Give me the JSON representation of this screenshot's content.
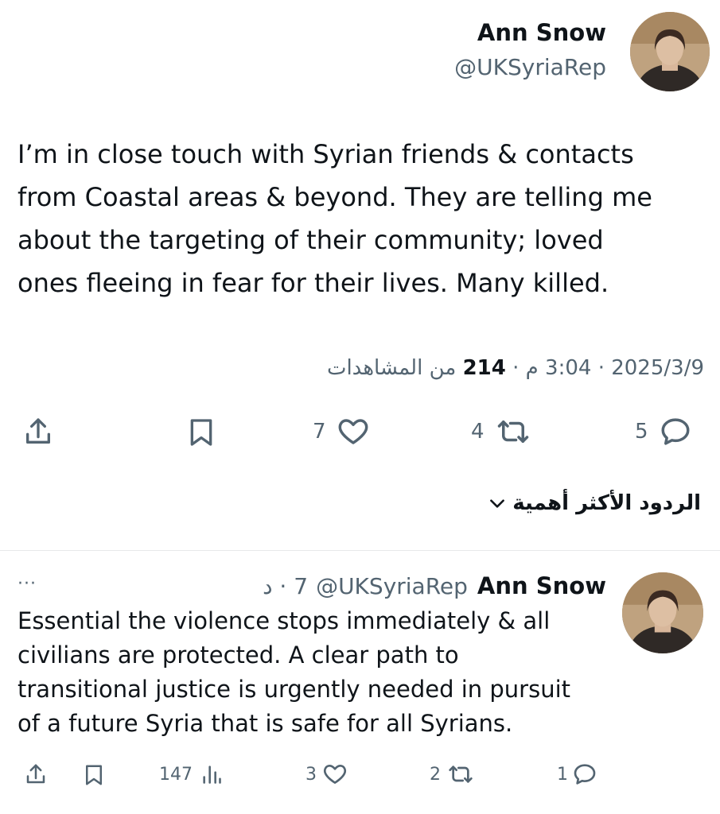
{
  "tweet": {
    "author_name": "Ann Snow",
    "author_handle": "@UKSyriaRep",
    "text": "I’m in close touch with Syrian friends & contacts\nfrom Coastal areas & beyond. They are telling me\nabout the targeting of their community; loved\nones fleeing in fear for their lives. Many killed.",
    "date": "2025/3/9",
    "time": "3:04 م",
    "views_count": "214",
    "views_label": "من المشاهدات",
    "separator": "·",
    "replies": "5",
    "retweets": "4",
    "likes": "7"
  },
  "replies_sort": {
    "label": "الردود الأكثر أهمية"
  },
  "reply": {
    "author_name": "Ann Snow",
    "author_handle": "@UKSyriaRep",
    "time_ago": "7 · د",
    "more": "···",
    "text": "Essential the violence stops immediately & all\ncivilians are protected. A clear path to\ntransitional justice is urgently needed in pursuit\nof a future Syria that is safe for all Syrians.",
    "replies": "1",
    "retweets": "2",
    "likes": "3",
    "views": "147"
  },
  "icons": {
    "reply": "reply-icon",
    "retweet": "retweet-icon",
    "like": "heart-icon",
    "bookmark": "bookmark-icon",
    "share": "share-icon",
    "views": "views-icon",
    "chevron": "chevron-down-icon"
  },
  "colors": {
    "text": "#0f1419",
    "secondary": "#536471",
    "divider": "#e7e9ea"
  }
}
